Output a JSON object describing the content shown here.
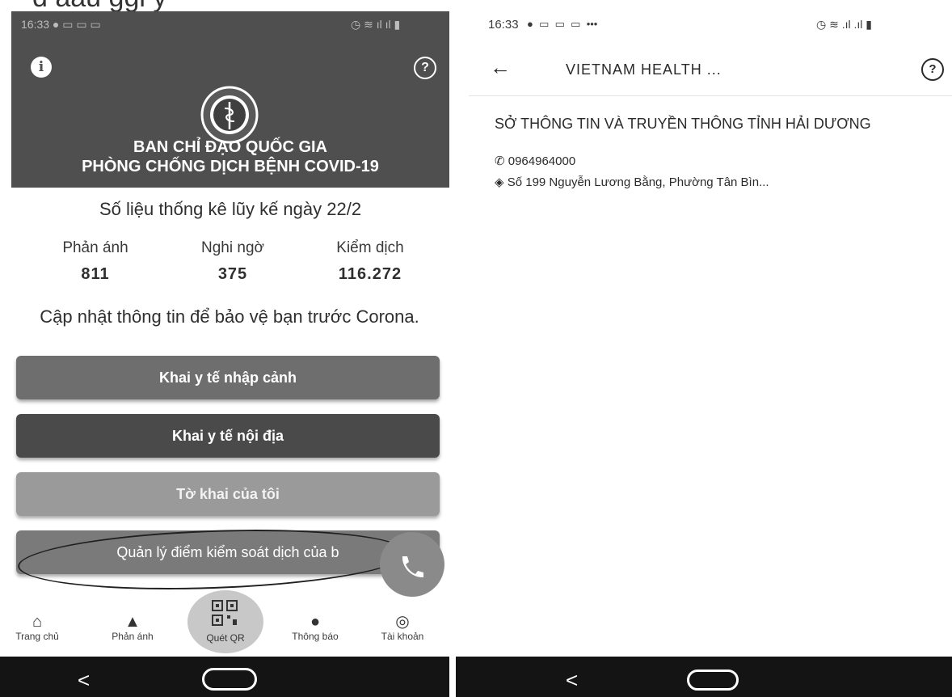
{
  "left_screen": {
    "header": {
      "title_line1": "BAN CHỈ ĐẠO QUỐC GIA",
      "title_line2": "PHÒNG CHỐNG DỊCH BỆNH COVID-19"
    },
    "stats": {
      "title": "Số liệu thống kê lũy kế ngày 22/2",
      "items": [
        {
          "label": "Phản ánh",
          "value": "811"
        },
        {
          "label": "Nghi ngờ",
          "value": "375"
        },
        {
          "label": "Kiểm dịch",
          "value": "116.272"
        }
      ]
    },
    "update_message": "Cập nhật thông tin để bảo vệ bạn trước Corona.",
    "buttons": {
      "entry_declaration": "Khai y tế nhập cảnh",
      "domestic_declaration": "Khai y tế nội địa",
      "my_declarations": "Tờ khai của tôi",
      "manage_checkpoints": "Quản lý điểm kiểm soát dịch của b"
    },
    "bottom_nav": {
      "home": "Trang chủ",
      "report": "Phản ánh",
      "scan_qr": "Quét QR",
      "notifications": "Thông báo",
      "account": "Tài khoản"
    }
  },
  "right_screen": {
    "status_bar": {
      "time": "16:33",
      "extra": "•••"
    },
    "title": "VIETNAM HEALTH ...",
    "contact": {
      "org_name": "SỞ THÔNG TIN VÀ TRUYỀN THÔNG TỈNH HẢI DƯƠNG",
      "phone": "0964964000",
      "address": "Số 199 Nguyễn Lương Bằng, Phường Tân Bìn..."
    }
  },
  "colors": {
    "header_bg": "#4f4f4f",
    "button_dark": "#4a4a4a",
    "button_light": "#9a9a9a",
    "system_bar": "#141414"
  }
}
